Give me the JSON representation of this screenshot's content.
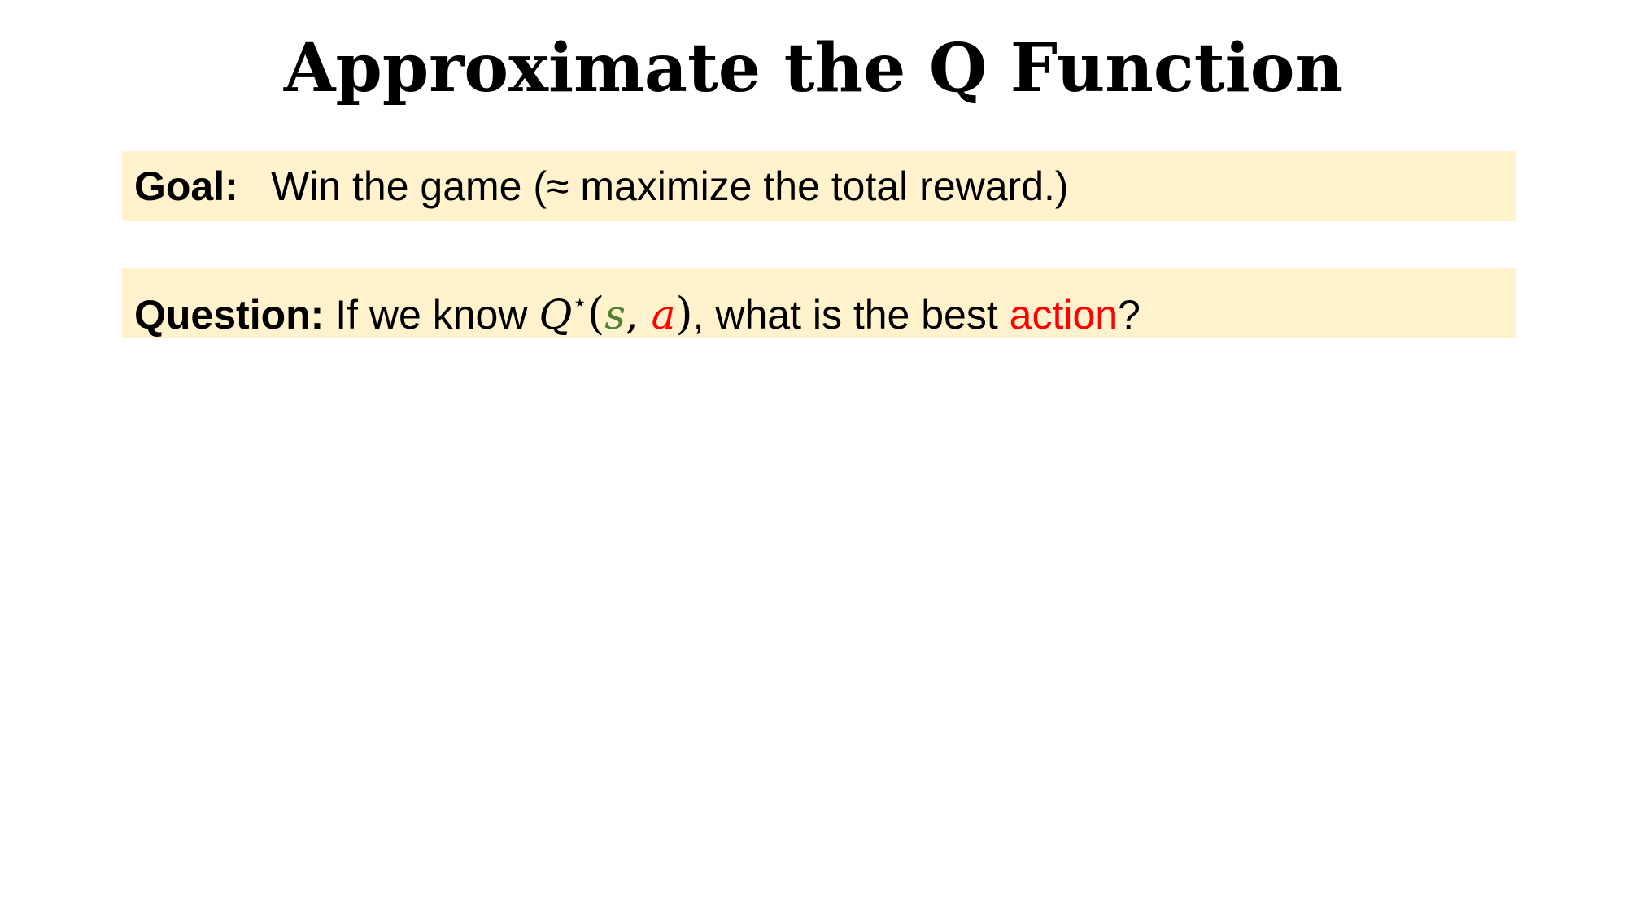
{
  "slide": {
    "title": "Approximate the Q Function"
  },
  "goal": {
    "label": "Goal:",
    "text": "Win the game (≈ maximize the total reward.)"
  },
  "question": {
    "label": "Question:",
    "text_before": "If we know ",
    "q_symbol": "Q",
    "star": "⋆",
    "open_paren": "(",
    "state_var": "s",
    "comma": ", ",
    "action_var": "a",
    "close_paren": ")",
    "text_middle": ", what is the best ",
    "highlight_word": "action",
    "text_after": "?"
  },
  "colors": {
    "box_background": "#fff2cc",
    "state_color": "#548235",
    "action_color": "#ff0000",
    "text": "#000000"
  }
}
